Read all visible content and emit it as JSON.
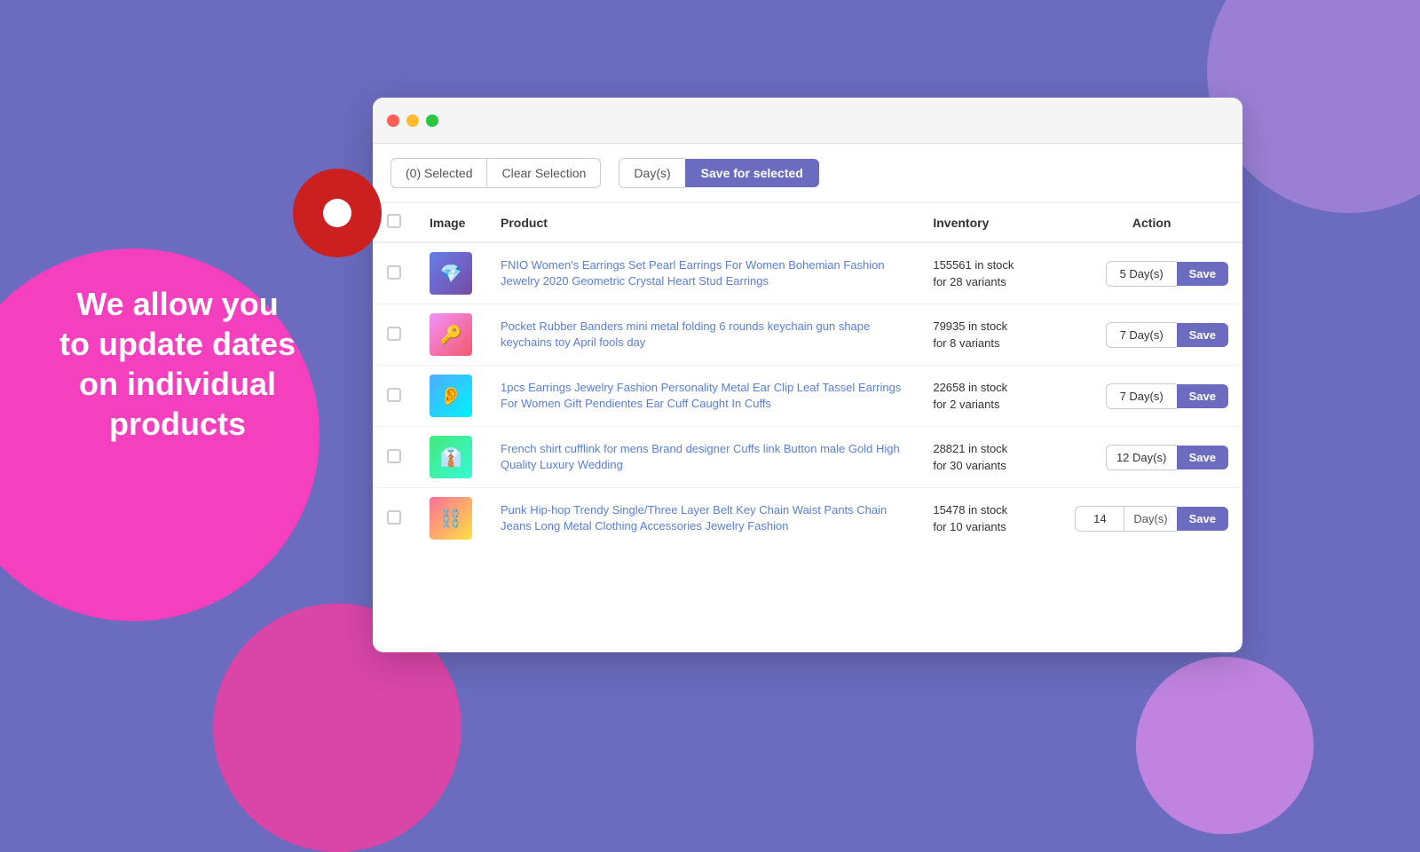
{
  "background": {
    "color": "#6b6bbf"
  },
  "leftText": {
    "line1": "We allow you",
    "line2": "to update dates",
    "line3": "on individual",
    "line4": "products"
  },
  "browser": {
    "trafficDots": [
      "red",
      "yellow",
      "green"
    ],
    "toolbar": {
      "selectedLabel": "(0) Selected",
      "clearLabel": "Clear Selection",
      "daysLabel": "Day(s)",
      "saveSelectedLabel": "Save for selected"
    },
    "table": {
      "headers": [
        "",
        "Image",
        "Product",
        "Inventory",
        "Action"
      ],
      "actionHeader": "Action",
      "products": [
        {
          "id": 1,
          "name": "FNIO Women's Earrings Set Pearl Earrings For Women Bohemian Fashion Jewelry 2020 Geometric Crystal Heart Stud Earrings",
          "inventory": "155561 in stock",
          "variants": "for 28 variants",
          "days": "5",
          "daysLabel": "Day(s)"
        },
        {
          "id": 2,
          "name": "Pocket Rubber Banders mini metal folding 6 rounds keychain gun shape keychains toy April fools day",
          "inventory": "79935 in stock",
          "variants": "for 8 variants",
          "days": "7",
          "daysLabel": "Day(s)"
        },
        {
          "id": 3,
          "name": "1pcs Earrings Jewelry Fashion Personality Metal Ear Clip Leaf Tassel Earrings For Women Gift Pendientes Ear Cuff Caught In Cuffs",
          "inventory": "22658 in stock",
          "variants": "for 2 variants",
          "days": "7",
          "daysLabel": "Day(s)"
        },
        {
          "id": 4,
          "name": "French shirt cufflink for mens Brand designer Cuffs link Button male Gold High Quality Luxury Wedding",
          "inventory": "28821 in stock",
          "variants": "for 30 variants",
          "days": "12",
          "daysLabel": "Day(s)"
        },
        {
          "id": 5,
          "name": "Punk Hip-hop Trendy Single/Three Layer Belt Key Chain Waist Pants Chain Jeans Long Metal Clothing Accessories Jewelry Fashion",
          "inventory": "15478 in stock",
          "variants": "for 10 variants",
          "days": "14",
          "daysLabel": "Day(s)"
        }
      ],
      "saveButtonLabel": "Save"
    }
  }
}
